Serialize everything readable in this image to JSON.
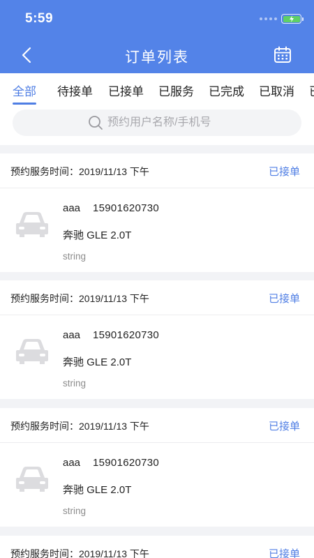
{
  "status_bar": {
    "time": "5:59"
  },
  "nav": {
    "title": "订单列表",
    "back_icon": "chevron-left-icon",
    "calendar_icon": "calendar-icon"
  },
  "tabs": [
    {
      "label": "全部",
      "active": true
    },
    {
      "label": "待接单",
      "active": false
    },
    {
      "label": "已接单",
      "active": false
    },
    {
      "label": "已服务",
      "active": false
    },
    {
      "label": "已完成",
      "active": false
    },
    {
      "label": "已取消",
      "active": false
    },
    {
      "label": "已",
      "active": false
    }
  ],
  "search": {
    "placeholder": "预约用户名称/手机号"
  },
  "orders": [
    {
      "appointment": "预约服务时间：2019/11/13 下午",
      "status": "已接单",
      "user": "aaa",
      "phone": "15901620730",
      "car": "奔驰 GLE 2.0T",
      "note": "string"
    },
    {
      "appointment": "预约服务时间：2019/11/13 下午",
      "status": "已接单",
      "user": "aaa",
      "phone": "15901620730",
      "car": "奔驰 GLE 2.0T",
      "note": "string"
    },
    {
      "appointment": "预约服务时间：2019/11/13 下午",
      "status": "已接单",
      "user": "aaa",
      "phone": "15901620730",
      "car": "奔驰 GLE 2.0T",
      "note": "string"
    },
    {
      "appointment": "预约服务时间：2019/11/13 下午",
      "status": "已接单"
    }
  ],
  "colors": {
    "brand": "#5383e8",
    "accent": "#4f7ee4",
    "background": "#f2f3f6"
  }
}
